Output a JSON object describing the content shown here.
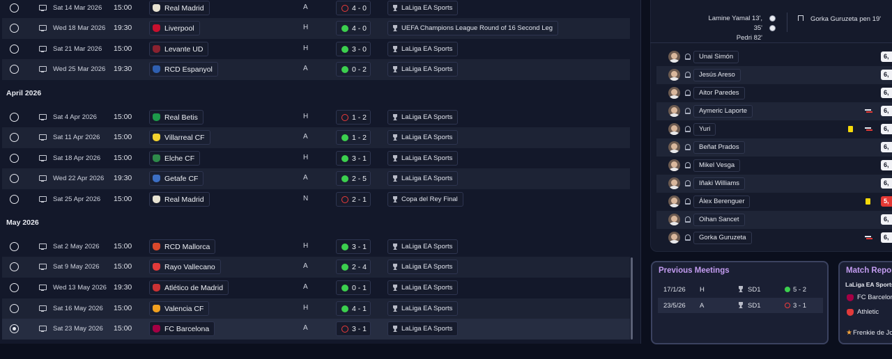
{
  "fixtures": {
    "rows": [
      {
        "date": "Sat 14 Mar 2026",
        "time": "15:00",
        "opponent": "Real Madrid",
        "crest_color": "#e8e3d2",
        "venue": "A",
        "result": "4 - 0",
        "outcome": "loss",
        "competition": "LaLiga EA Sports"
      },
      {
        "date": "Wed 18 Mar 2026",
        "time": "19:30",
        "opponent": "Liverpool",
        "crest_color": "#c8102e",
        "venue": "H",
        "result": "4 - 0",
        "outcome": "win",
        "competition": "UEFA Champions League Round of 16  Second Leg"
      },
      {
        "date": "Sat 21 Mar 2026",
        "time": "15:00",
        "opponent": "Levante UD",
        "crest_color": "#8a2230",
        "venue": "H",
        "result": "3 - 0",
        "outcome": "win",
        "competition": "LaLiga EA Sports"
      },
      {
        "date": "Wed 25 Mar 2026",
        "time": "19:30",
        "opponent": "RCD Espanyol",
        "crest_color": "#2f5fb0",
        "venue": "A",
        "result": "0 - 2",
        "outcome": "win",
        "competition": "LaLiga EA Sports"
      }
    ],
    "april_header": "April 2026",
    "april_rows": [
      {
        "date": "Sat 4 Apr 2026",
        "time": "15:00",
        "opponent": "Real Betis",
        "crest_color": "#1d9a4a",
        "venue": "H",
        "result": "1 - 2",
        "outcome": "loss",
        "competition": "LaLiga EA Sports"
      },
      {
        "date": "Sat 11 Apr 2026",
        "time": "15:00",
        "opponent": "Villarreal CF",
        "crest_color": "#f2d22e",
        "venue": "A",
        "result": "1 - 2",
        "outcome": "win",
        "competition": "LaLiga EA Sports"
      },
      {
        "date": "Sat 18 Apr 2026",
        "time": "15:00",
        "opponent": "Elche CF",
        "crest_color": "#2e8a4a",
        "venue": "H",
        "result": "3 - 1",
        "outcome": "win",
        "competition": "LaLiga EA Sports"
      },
      {
        "date": "Wed 22 Apr 2026",
        "time": "19:30",
        "opponent": "Getafe CF",
        "crest_color": "#3c6fc4",
        "venue": "A",
        "result": "2 - 5",
        "outcome": "win",
        "competition": "LaLiga EA Sports"
      },
      {
        "date": "Sat 25 Apr 2026",
        "time": "15:00",
        "opponent": "Real Madrid",
        "crest_color": "#e8e3d2",
        "venue": "N",
        "result": "2 - 1",
        "outcome": "loss",
        "competition": "Copa del Rey Final"
      }
    ],
    "may_header": "May 2026",
    "may_rows": [
      {
        "date": "Sat 2 May 2026",
        "time": "15:00",
        "opponent": "RCD Mallorca",
        "crest_color": "#d9482b",
        "venue": "H",
        "result": "3 - 1",
        "outcome": "win",
        "competition": "LaLiga EA Sports"
      },
      {
        "date": "Sat 9 May 2026",
        "time": "15:00",
        "opponent": "Rayo Vallecano",
        "crest_color": "#e23a3a",
        "venue": "A",
        "result": "2 - 4",
        "outcome": "win",
        "competition": "LaLiga EA Sports"
      },
      {
        "date": "Wed 13 May 2026",
        "time": "19:30",
        "opponent": "Atlético de Madrid",
        "crest_color": "#cb3234",
        "venue": "A",
        "result": "0 - 1",
        "outcome": "win",
        "competition": "LaLiga EA Sports"
      },
      {
        "date": "Sat 16 May 2026",
        "time": "15:00",
        "opponent": "Valencia CF",
        "crest_color": "#f0a020",
        "venue": "H",
        "result": "4 - 1",
        "outcome": "win",
        "competition": "LaLiga EA Sports"
      },
      {
        "date": "Sat 23 May 2026",
        "time": "15:00",
        "opponent": "FC Barcelona",
        "crest_color": "#a50044",
        "venue": "A",
        "result": "3 - 1",
        "outcome": "loss",
        "competition": "LaLiga EA Sports",
        "selected": true
      }
    ]
  },
  "match_detail": {
    "scorers_home": [
      "Lamine Yamal 13', 35'",
      "Pedri 82'"
    ],
    "scorers_away": "Gorka Guruzeta pen 19'",
    "players": [
      {
        "name": "Unai Simón",
        "rating": "6,"
      },
      {
        "name": "Jesús Areso",
        "rating": "6,"
      },
      {
        "name": "Aitor Paredes",
        "rating": "6,"
      },
      {
        "name": "Aymeric Laporte",
        "rating": "6,",
        "sub": true
      },
      {
        "name": "Yuri",
        "rating": "6,",
        "sub": true,
        "yellow": true
      },
      {
        "name": "Beñat Prados",
        "rating": "6,"
      },
      {
        "name": "Mikel Vesga",
        "rating": "6,"
      },
      {
        "name": "Iñaki Williams",
        "rating": "6,"
      },
      {
        "name": "Álex Berenguer",
        "rating": "5,",
        "yellow": true,
        "low": true
      },
      {
        "name": "Oihan Sancet",
        "rating": "6,"
      },
      {
        "name": "Gorka Guruzeta",
        "rating": "6,",
        "sub": true
      }
    ]
  },
  "previous_meetings": {
    "title": "Previous Meetings",
    "rows": [
      {
        "date": "17/1/26",
        "venue": "H",
        "competition": "SD1",
        "result": "5 - 2",
        "outcome": "win"
      },
      {
        "date": "23/5/26",
        "venue": "A",
        "competition": "SD1",
        "result": "3 - 1",
        "outcome": "loss"
      }
    ]
  },
  "match_report": {
    "title": "Match Report",
    "competition": "LaLiga EA Sports",
    "home_team": "FC Barcelona",
    "away_team": "Athletic",
    "player_of_match": "Frenkie de Jo"
  }
}
